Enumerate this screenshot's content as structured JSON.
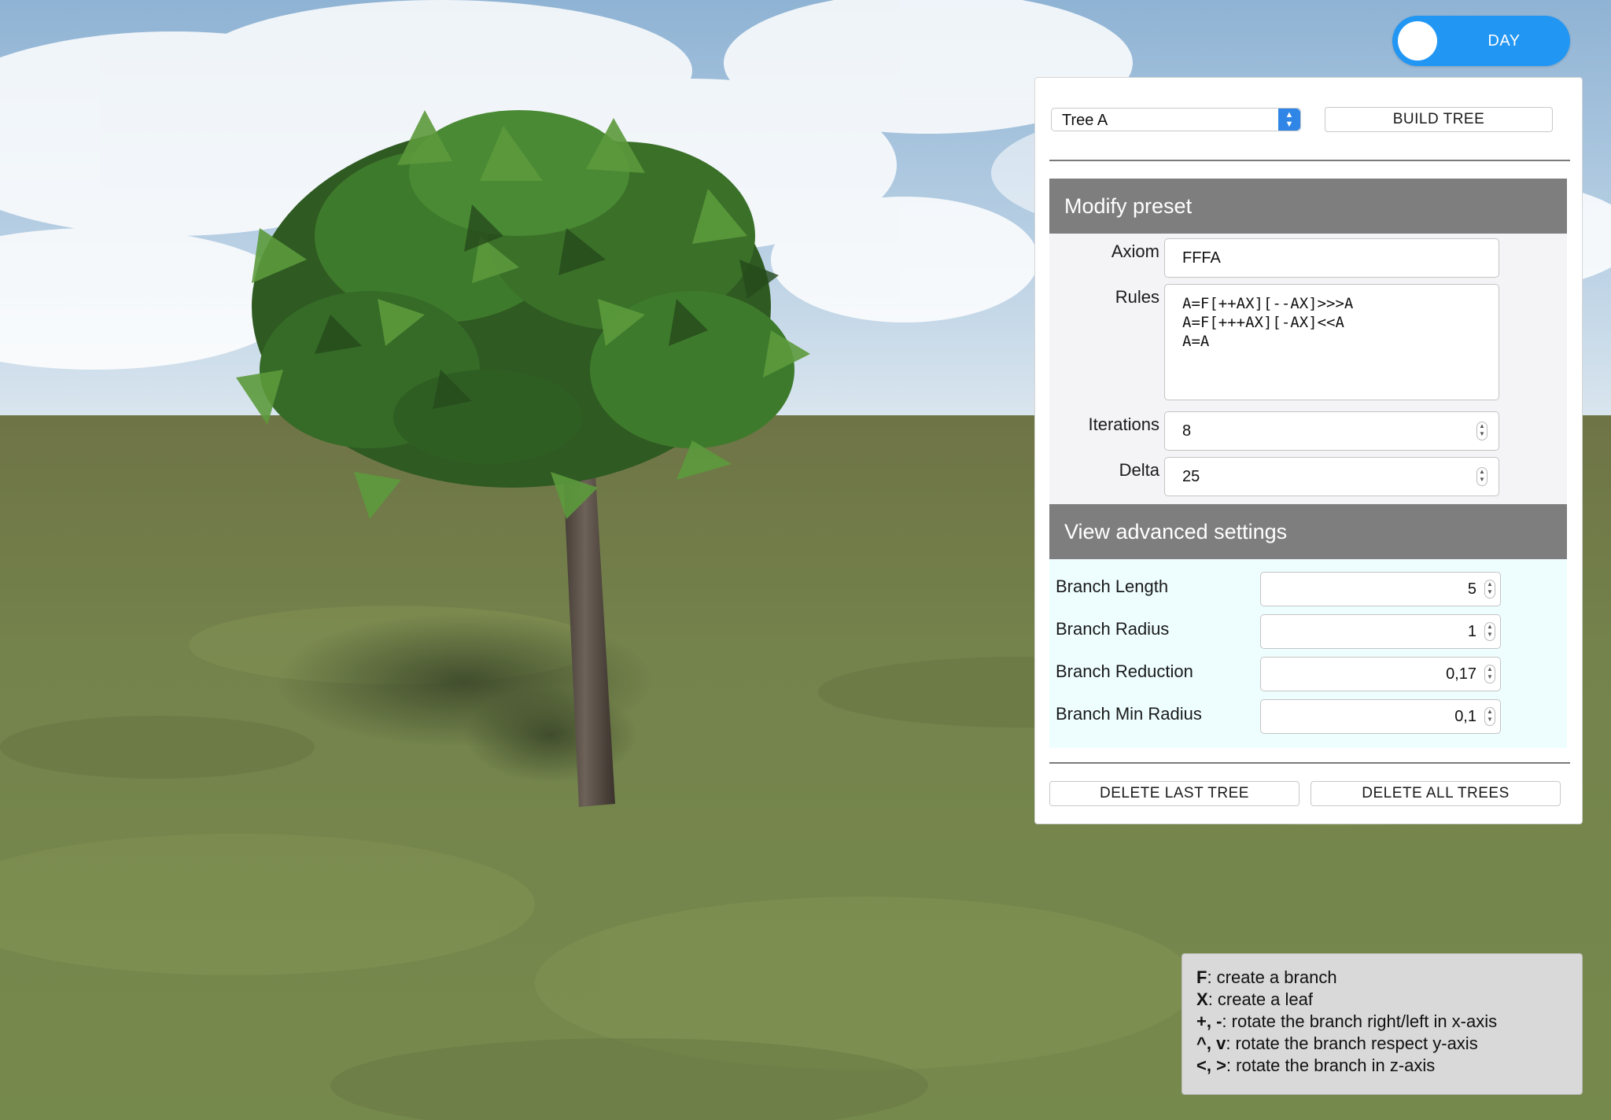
{
  "day_toggle": {
    "label": "DAY",
    "on": true,
    "color": "#2196f3"
  },
  "panel": {
    "preset_select": {
      "selected": "Tree A"
    },
    "build_button": "BUILD TREE",
    "modify_preset": {
      "title": "Modify preset",
      "axiom": {
        "label": "Axiom",
        "value": "FFFA"
      },
      "rules": {
        "label": "Rules",
        "lines": [
          "A=F[++AX][--AX]>>>A",
          "A=F[+++AX][-AX]<<A",
          "A=A"
        ]
      },
      "iterations": {
        "label": "Iterations",
        "value": "8"
      },
      "delta": {
        "label": "Delta",
        "value": "25"
      }
    },
    "advanced": {
      "title": "View advanced settings",
      "branch_length": {
        "label": "Branch Length",
        "value": "5"
      },
      "branch_radius": {
        "label": "Branch Radius",
        "value": "1"
      },
      "branch_reduction": {
        "label": "Branch Reduction",
        "value": "0,17"
      },
      "branch_min_radius": {
        "label": "Branch Min Radius",
        "value": "0,1"
      }
    },
    "delete_last": "DELETE LAST TREE",
    "delete_all": "DELETE ALL TREES"
  },
  "legend": {
    "items": [
      {
        "key": "F",
        "text": ": create a branch"
      },
      {
        "key": "X",
        "text": ": create a leaf"
      },
      {
        "key": "+, -",
        "text": ": rotate the branch right/left in x-axis"
      },
      {
        "key": "^, v",
        "text": ": rotate the branch respect y-axis"
      },
      {
        "key": "<, >",
        "text": ": rotate the branch in z-axis"
      }
    ]
  },
  "colors": {
    "accent": "#2196f3",
    "section_header": "#7e7e7e",
    "advanced_bg": "#eefeff"
  }
}
